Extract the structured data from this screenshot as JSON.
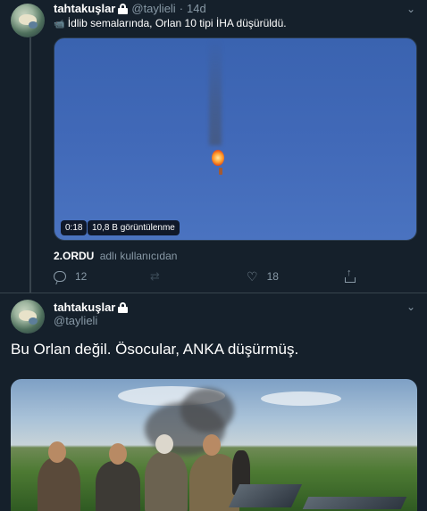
{
  "tweet1": {
    "display_name": "tahtakuşlar",
    "handle": "@taylieli",
    "separator": "·",
    "time": "14d",
    "text": "İdlib semalarında, Orlan 10 tipi İHA düşürüldü.",
    "video": {
      "duration": "0:18",
      "views": "10,8 B görüntülenme"
    },
    "mention": {
      "name": "2.ORDU",
      "rest": "adlı kullanıcıdan"
    },
    "actions": {
      "reply_count": "12",
      "retweet_count": "",
      "like_count": "18"
    }
  },
  "tweet2": {
    "display_name": "tahtakuşlar",
    "handle": "@taylieli",
    "text": "Bu Orlan değil. Ösocular, ANKA düşürmüş."
  },
  "icons": {
    "lock": "lock-icon",
    "chevron": "chevron-down-icon",
    "reply": "reply-icon",
    "retweet": "retweet-icon",
    "like": "heart-icon",
    "share": "share-icon"
  },
  "colors": {
    "background": "#15202b",
    "secondary_text": "#8899a6",
    "divider": "#38444d"
  }
}
